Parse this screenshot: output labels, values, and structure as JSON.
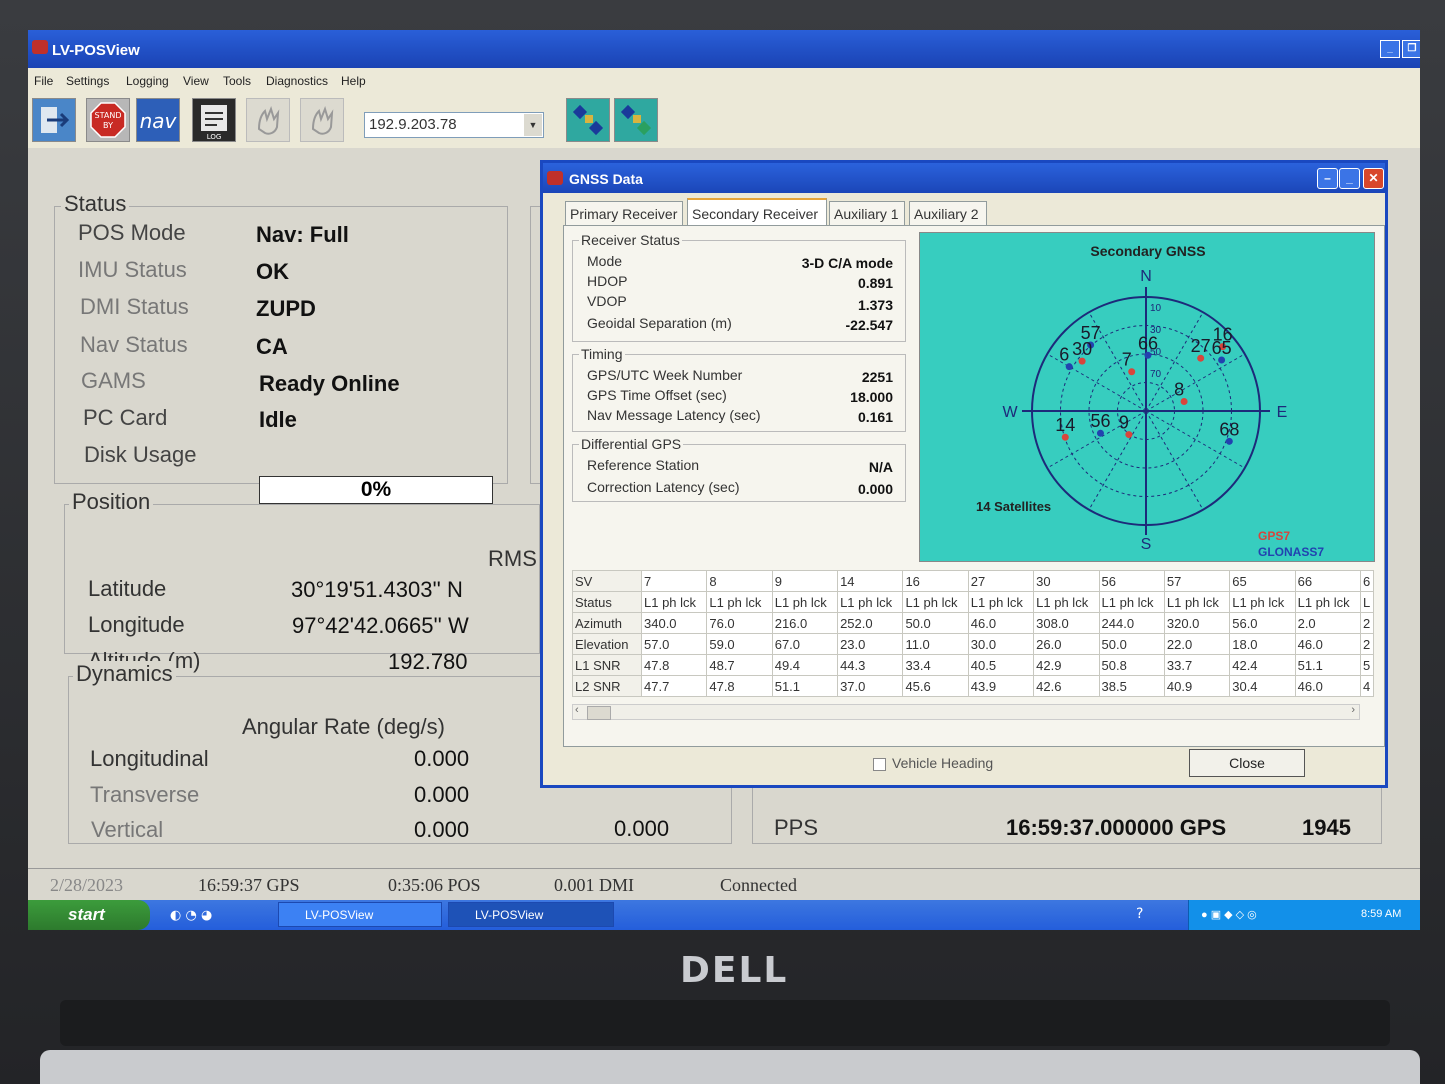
{
  "window": {
    "title": "LV-POSView"
  },
  "menu": [
    "File",
    "Settings",
    "Logging",
    "View",
    "Tools",
    "Diagnostics",
    "Help"
  ],
  "toolbar": {
    "ip_address": "192.9.203.78"
  },
  "status": {
    "title": "Status",
    "rows": [
      {
        "label": "POS Mode",
        "value": "Nav: Full"
      },
      {
        "label": "IMU Status",
        "value": "OK"
      },
      {
        "label": "DMI Status",
        "value": "ZUPD"
      },
      {
        "label": "Nav Status",
        "value": "CA"
      },
      {
        "label": "GAMS",
        "value": "Ready Online"
      },
      {
        "label": "PC Card",
        "value": "Idle"
      }
    ],
    "disk_label": "Disk Usage",
    "disk_value": "0%"
  },
  "position": {
    "title": "Position",
    "rms_label": "RMS",
    "latitude_label": "Latitude",
    "latitude": "30°19'51.4303'' N",
    "longitude_label": "Longitude",
    "longitude": "97°42'42.0665'' W",
    "altitude_label": "Altitude (m)",
    "altitude": "192.780"
  },
  "dynamics": {
    "title": "Dynamics",
    "header": "Angular Rate (deg/s)",
    "longitudinal_label": "Longitudinal",
    "longitudinal": "0.000",
    "transverse_label": "Transverse",
    "transverse": "0.000",
    "vertical_label": "Vertical",
    "vertical": "0.000",
    "vertical_extra": "0.000"
  },
  "pps": {
    "label": "PPS",
    "time": "16:59:37.000000 GPS",
    "count": "1945"
  },
  "statusbar": {
    "date": "2/28/2023",
    "gps_time": "16:59:37 GPS",
    "pos_time": "0:35:06 POS",
    "dmi": "0.001 DMI",
    "connection": "Connected"
  },
  "taskbar": {
    "start": "start",
    "items": [
      "LV-POSView",
      "LV-POSView"
    ],
    "clock": "8:59 AM"
  },
  "gnss": {
    "title": "GNSS Data",
    "tabs": [
      "Primary Receiver",
      "Secondary Receiver",
      "Auxiliary 1",
      "Auxiliary 2"
    ],
    "receiver_status": {
      "title": "Receiver Status",
      "mode_label": "Mode",
      "mode": "3-D C/A mode",
      "hdop_label": "HDOP",
      "hdop": "0.891",
      "vdop_label": "VDOP",
      "vdop": "1.373",
      "geoid_label": "Geoidal Separation (m)",
      "geoid": "-22.547"
    },
    "timing": {
      "title": "Timing",
      "week_label": "GPS/UTC Week Number",
      "week": "2251",
      "offset_label": "GPS Time Offset (sec)",
      "offset": "18.000",
      "latency_label": "Nav Message Latency (sec)",
      "latency": "0.161"
    },
    "dgps": {
      "title": "Differential GPS",
      "station_label": "Reference Station",
      "station": "N/A",
      "corr_label": "Correction Latency (sec)",
      "corr": "0.000"
    },
    "sky": {
      "title": "Secondary GNSS",
      "count": "14 Satellites",
      "legend_gps": "GPS7",
      "legend_glonass": "GLONASS7",
      "directions": [
        "N",
        "E",
        "S",
        "W"
      ],
      "rings": [
        "10",
        "30",
        "50",
        "70"
      ],
      "colors": {
        "gps": "#d8453c",
        "glonass": "#2242b0",
        "background": "#37cdbf"
      },
      "sats": [
        {
          "id": "57",
          "type": "glonass",
          "az": 320,
          "el": 22
        },
        {
          "id": "30",
          "type": "gps",
          "az": 308,
          "el": 26
        },
        {
          "id": "6",
          "type": "glonass",
          "az": 300,
          "el": 20
        },
        {
          "id": "7",
          "type": "gps",
          "az": 340,
          "el": 57
        },
        {
          "id": "66",
          "type": "glonass",
          "az": 2,
          "el": 46
        },
        {
          "id": "27",
          "type": "gps",
          "az": 46,
          "el": 30
        },
        {
          "id": "16",
          "type": "gps",
          "az": 50,
          "el": 11
        },
        {
          "id": "65",
          "type": "glonass",
          "az": 56,
          "el": 18
        },
        {
          "id": "8",
          "type": "gps",
          "az": 76,
          "el": 59
        },
        {
          "id": "14",
          "type": "gps",
          "az": 252,
          "el": 23
        },
        {
          "id": "56",
          "type": "glonass",
          "az": 244,
          "el": 50
        },
        {
          "id": "9",
          "type": "gps",
          "az": 216,
          "el": 67
        },
        {
          "id": "68",
          "type": "glonass",
          "az": 110,
          "el": 20
        }
      ]
    },
    "table": {
      "rows": [
        [
          "SV",
          "7",
          "8",
          "9",
          "14",
          "16",
          "27",
          "30",
          "56",
          "57",
          "65",
          "66",
          "6"
        ],
        [
          "Status",
          "L1 ph lck",
          "L1 ph lck",
          "L1 ph lck",
          "L1 ph lck",
          "L1 ph lck",
          "L1 ph lck",
          "L1 ph lck",
          "L1 ph lck",
          "L1 ph lck",
          "L1 ph lck",
          "L1 ph lck",
          "L"
        ],
        [
          "Azimuth",
          "340.0",
          "76.0",
          "216.0",
          "252.0",
          "50.0",
          "46.0",
          "308.0",
          "244.0",
          "320.0",
          "56.0",
          "2.0",
          "2"
        ],
        [
          "Elevation",
          "57.0",
          "59.0",
          "67.0",
          "23.0",
          "11.0",
          "30.0",
          "26.0",
          "50.0",
          "22.0",
          "18.0",
          "46.0",
          "2"
        ],
        [
          "L1 SNR",
          "47.8",
          "48.7",
          "49.4",
          "44.3",
          "33.4",
          "40.5",
          "42.9",
          "50.8",
          "33.7",
          "42.4",
          "51.1",
          "5"
        ],
        [
          "L2 SNR",
          "47.7",
          "47.8",
          "51.1",
          "37.0",
          "45.6",
          "43.9",
          "42.6",
          "38.5",
          "40.9",
          "30.4",
          "46.0",
          "4"
        ]
      ]
    },
    "vehicle_heading": "Vehicle Heading",
    "close": "Close"
  },
  "bezel": {
    "brand": "DELL"
  }
}
